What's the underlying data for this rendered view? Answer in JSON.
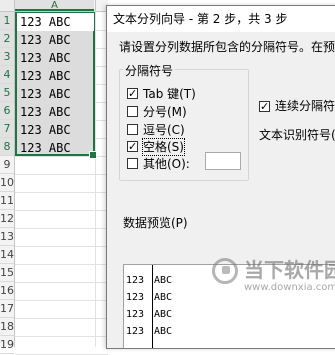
{
  "sheet": {
    "column_header": "A",
    "rows": [
      {
        "num": "1",
        "value": "123 ABC"
      },
      {
        "num": "2",
        "value": "123 ABC"
      },
      {
        "num": "3",
        "value": "123 ABC"
      },
      {
        "num": "4",
        "value": "123 ABC"
      },
      {
        "num": "5",
        "value": "123 ABC"
      },
      {
        "num": "6",
        "value": "123 ABC"
      },
      {
        "num": "7",
        "value": "123 ABC"
      },
      {
        "num": "8",
        "value": "123 ABC"
      },
      {
        "num": "9",
        "value": ""
      },
      {
        "num": "10",
        "value": ""
      },
      {
        "num": "11",
        "value": ""
      },
      {
        "num": "12",
        "value": ""
      },
      {
        "num": "13",
        "value": ""
      },
      {
        "num": "14",
        "value": ""
      },
      {
        "num": "15",
        "value": ""
      },
      {
        "num": "16",
        "value": ""
      },
      {
        "num": "17",
        "value": ""
      },
      {
        "num": "18",
        "value": ""
      },
      {
        "num": "19",
        "value": ""
      }
    ],
    "accent_color": "#217346"
  },
  "dialog": {
    "title": "文本分列向导 - 第 2 步，共 3 步",
    "instruction": "请设置分列数据所包含的分隔符号。在预",
    "delimiters": {
      "legend": "分隔符号",
      "tab": {
        "label": "Tab 键(T)",
        "checked": true
      },
      "semicolon": {
        "label": "分号(M)",
        "checked": false
      },
      "comma": {
        "label": "逗号(C)",
        "checked": false
      },
      "space": {
        "label": "空格(S)",
        "checked": true
      },
      "other": {
        "label": "其他(O):",
        "checked": false,
        "value": ""
      }
    },
    "consecutive": {
      "label": "连续分隔符",
      "checked": true
    },
    "qualifier_label": "文本识别符号(",
    "preview": {
      "label": "数据预览(P)",
      "rows": [
        {
          "c1": "123",
          "c2": "ABC"
        },
        {
          "c1": "123",
          "c2": "ABC"
        },
        {
          "c1": "123",
          "c2": "ABC"
        },
        {
          "c1": "123",
          "c2": "ABC"
        }
      ]
    }
  },
  "watermark": {
    "text": "当下软件园",
    "url": "www.downxia.com",
    "icon": "downxia-logo-icon"
  }
}
